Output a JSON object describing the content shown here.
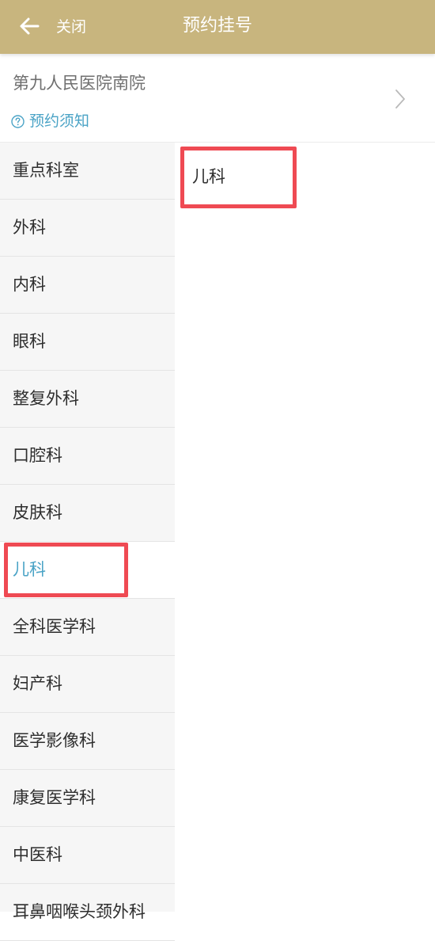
{
  "header": {
    "close_label": "关闭",
    "title": "预约挂号",
    "background_color": "#c8b57e"
  },
  "hospital": {
    "name": "第九人民医院南院",
    "notice_label": "预约须知"
  },
  "sidebar": {
    "items": [
      {
        "label": "重点科室"
      },
      {
        "label": "外科"
      },
      {
        "label": "内科"
      },
      {
        "label": "眼科"
      },
      {
        "label": "整复外科"
      },
      {
        "label": "口腔科"
      },
      {
        "label": "皮肤科"
      },
      {
        "label": "儿科",
        "selected": true
      },
      {
        "label": "全科医学科"
      },
      {
        "label": "妇产科"
      },
      {
        "label": "医学影像科"
      },
      {
        "label": "康复医学科"
      },
      {
        "label": "中医科"
      },
      {
        "label": "耳鼻咽喉头颈外科"
      }
    ]
  },
  "content": {
    "items": [
      {
        "label": "儿科"
      }
    ]
  },
  "colors": {
    "accent": "#4aa3c6",
    "highlight_box": "#ef4a53"
  }
}
